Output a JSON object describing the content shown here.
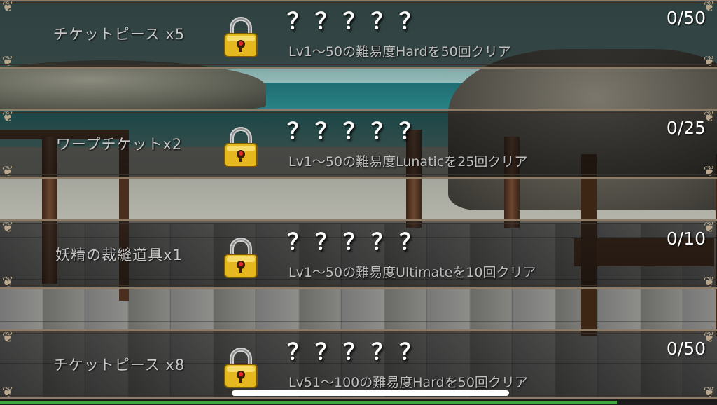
{
  "achievements": [
    {
      "reward": "チケットピース x5",
      "title": "？？？？？",
      "condition": "Lv1～50の難易度Hardを50回クリア",
      "progress": "0/50"
    },
    {
      "reward": "ワープチケットx2",
      "title": "？？？？？",
      "condition": "Lv1～50の難易度Lunaticを25回クリア",
      "progress": "0/25"
    },
    {
      "reward": "妖精の裁縫道具x1",
      "title": "？？？？？",
      "condition": "Lv1～50の難易度Ultimateを10回クリア",
      "progress": "0/10"
    },
    {
      "reward": "チケットピース x8",
      "title": "？？？？？",
      "condition": "Lv51～100の難易度Hardを50回クリア",
      "progress": "0/50"
    }
  ],
  "icons": {
    "lock": "padlock-icon",
    "corner": "ornament-corner-icon"
  },
  "colors": {
    "lock_gold": "#e6b820",
    "frame": "#8c7b66",
    "progress_green": "#3ea83e"
  }
}
